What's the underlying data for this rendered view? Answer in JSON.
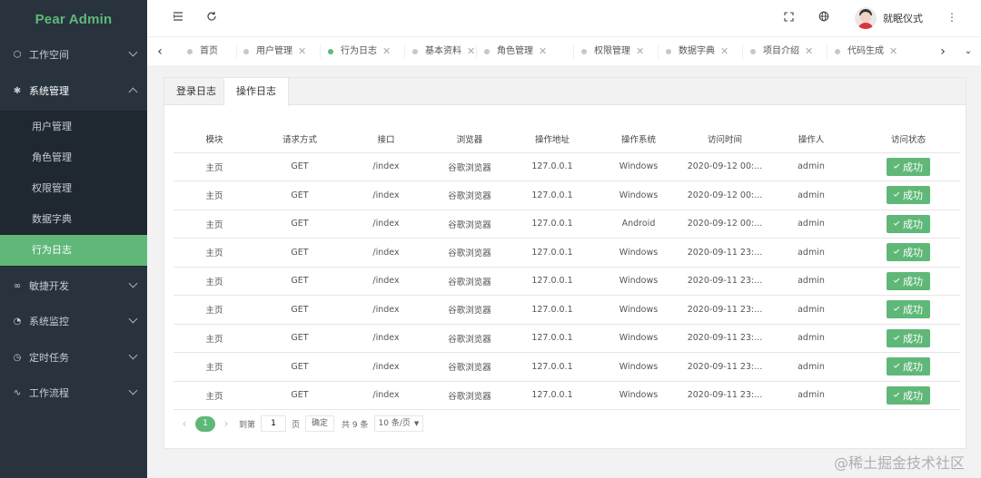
{
  "app": {
    "logo": "Pear Admin"
  },
  "sidebar": {
    "menus": [
      {
        "label": "工作空间",
        "icon": "cube-icon"
      },
      {
        "label": "系统管理",
        "icon": "gear-icon"
      },
      {
        "label": "敏捷开发",
        "icon": "infinity-icon"
      },
      {
        "label": "系统监控",
        "icon": "gauge-icon"
      },
      {
        "label": "定时任务",
        "icon": "clock-icon"
      },
      {
        "label": "工作流程",
        "icon": "pulse-icon"
      }
    ],
    "submenu": [
      "用户管理",
      "角色管理",
      "权限管理",
      "数据字典",
      "行为日志"
    ]
  },
  "header": {
    "menu_toggle_icon": "menu-toggle-icon",
    "refresh_icon": "refresh-icon",
    "fullscreen_icon": "fullscreen-icon",
    "globe_icon": "globe-icon",
    "username": "就眠仪式"
  },
  "tabs": [
    "首页",
    "用户管理",
    "行为日志",
    "基本资料",
    "角色管理",
    "权限管理",
    "数据字典",
    "项目介绍",
    "代码生成"
  ],
  "panel": {
    "tabs": [
      "登录日志",
      "操作日志"
    ],
    "columns": [
      "模块",
      "请求方式",
      "接口",
      "浏览器",
      "操作地址",
      "操作系统",
      "访问时间",
      "操作人",
      "访问状态"
    ],
    "rows": [
      [
        "主页",
        "GET",
        "/index",
        "谷歌浏览器",
        "127.0.0.1",
        "Windows",
        "2020-09-12 00:...",
        "admin",
        "成功"
      ],
      [
        "主页",
        "GET",
        "/index",
        "谷歌浏览器",
        "127.0.0.1",
        "Windows",
        "2020-09-12 00:...",
        "admin",
        "成功"
      ],
      [
        "主页",
        "GET",
        "/index",
        "谷歌浏览器",
        "127.0.0.1",
        "Android",
        "2020-09-12 00:...",
        "admin",
        "成功"
      ],
      [
        "主页",
        "GET",
        "/index",
        "谷歌浏览器",
        "127.0.0.1",
        "Windows",
        "2020-09-11 23:...",
        "admin",
        "成功"
      ],
      [
        "主页",
        "GET",
        "/index",
        "谷歌浏览器",
        "127.0.0.1",
        "Windows",
        "2020-09-11 23:...",
        "admin",
        "成功"
      ],
      [
        "主页",
        "GET",
        "/index",
        "谷歌浏览器",
        "127.0.0.1",
        "Windows",
        "2020-09-11 23:...",
        "admin",
        "成功"
      ],
      [
        "主页",
        "GET",
        "/index",
        "谷歌浏览器",
        "127.0.0.1",
        "Windows",
        "2020-09-11 23:...",
        "admin",
        "成功"
      ],
      [
        "主页",
        "GET",
        "/index",
        "谷歌浏览器",
        "127.0.0.1",
        "Windows",
        "2020-09-11 23:...",
        "admin",
        "成功"
      ],
      [
        "主页",
        "GET",
        "/index",
        "谷歌浏览器",
        "127.0.0.1",
        "Windows",
        "2020-09-11 23:...",
        "admin",
        "成功"
      ]
    ]
  },
  "pager": {
    "current": "1",
    "goto_prefix": "到第",
    "page_input": "1",
    "page_suffix": "页",
    "confirm": "确定",
    "total": "共 9 条",
    "page_size": "10 条/页"
  },
  "watermark": "@稀土掘金技术社区",
  "colors": {
    "accent": "#5fb878",
    "sidebar": "#28333e"
  }
}
